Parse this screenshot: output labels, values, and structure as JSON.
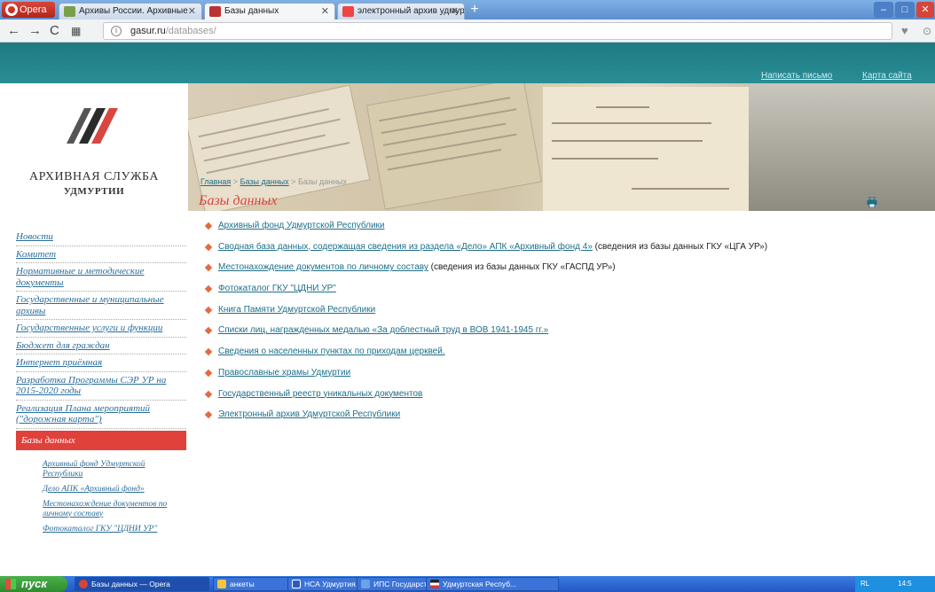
{
  "browser": {
    "menu_label": "Opera",
    "tabs": [
      {
        "label": "Архивы России. Архивные"
      },
      {
        "label": "Базы данных"
      },
      {
        "label": "электронный архив удмур"
      }
    ],
    "new_tab": "+",
    "url_host": "gasur.ru",
    "url_path": "/databases/"
  },
  "site": {
    "top_links": {
      "write": "Написать письмо",
      "sitemap": "Карта сайта"
    },
    "logo_line1": "АРХИВНАЯ СЛУЖБА",
    "logo_line2": "УДМУРТИИ",
    "breadcrumb": {
      "home": "Главная",
      "sep": ">",
      "databases": "Базы данных",
      "current": "Базы данных"
    },
    "page_title": "Базы данных",
    "items": [
      {
        "link": "Архивный фонд Удмуртской Республики",
        "note": ""
      },
      {
        "link": "Сводная база данных, содержащая сведения из раздела «Дело» АПК «Архивный фонд 4»",
        "note": "(сведения из базы данных ГКУ «ЦГА УР»)"
      },
      {
        "link": "Местонахождение документов по личному составу",
        "note": "(сведения из базы данных ГКУ «ГАСПД УР»)"
      },
      {
        "link": "Фотокаталог ГКУ \"ЦДНИ УР\"",
        "note": ""
      },
      {
        "link": "Книга Памяти Удмуртской Республики",
        "note": ""
      },
      {
        "link": "Списки лиц, награжденных медалью «За доблестный труд в ВОВ 1941-1945 гг.»",
        "note": ""
      },
      {
        "link": "Сведения о населенных пунктах по приходам церквей.",
        "note": ""
      },
      {
        "link": "Православные храмы Удмуртии",
        "note": ""
      },
      {
        "link": "Государственный реестр уникальных документов",
        "note": ""
      },
      {
        "link": "Электронный архив Удмуртской Республики",
        "note": ""
      }
    ],
    "sidebar": [
      "Новости",
      "Комитет",
      "Нормативные и методические документы",
      "Государственные и муниципальные архивы",
      "Государственные услуги и функции",
      "Бюджет для граждан",
      "Интернет приёмная",
      "Разработка Программы СЭР УР на 2015-2020 годы",
      "Реализация Плана мероприятий (\"дорожная карта\")"
    ],
    "sidebar_active": "Базы данных",
    "sidebar_sub": [
      "Архивный фонд Удмуртской Республики",
      "Дело АПК «Архивный фонд»",
      "Местонахождение документов по личному составу",
      "Фотокаталог ГКУ \"ЦДНИ УР\""
    ]
  },
  "taskbar": {
    "start": "пуск",
    "items": [
      {
        "label": "Базы данных — Opera"
      },
      {
        "label": "анкеты"
      },
      {
        "label": "НСА Удмуртия.doc -..."
      },
      {
        "label": "ИПС Государствен..."
      },
      {
        "label": "Удмуртская Респуб..."
      }
    ],
    "tray_lang": "RL",
    "clock": "14:5"
  },
  "colors": {
    "teal": "#1d7a83",
    "accent_red": "#e0413b",
    "link": "#1d6f8a"
  }
}
